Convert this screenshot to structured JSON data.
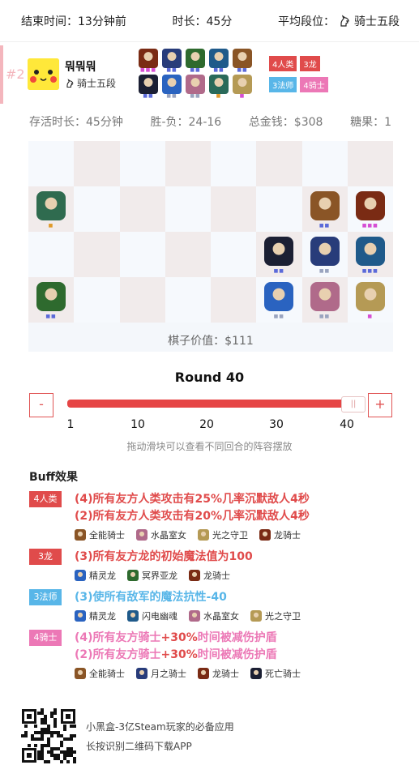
{
  "topbar": {
    "end_time": "结束时间：13分钟前",
    "duration": "时长：45分",
    "avg_rank": "平均段位：",
    "avg_rank_value": "骑士五段"
  },
  "player": {
    "rank": "#2",
    "name": "뭐뭐뭐",
    "tier": "骑士五段",
    "units": [
      {
        "color": "#7a2b14",
        "stars": 3,
        "star_color": "#d64fd4"
      },
      {
        "color": "#283c7a",
        "stars": 2,
        "star_color": "#5b6ad9"
      },
      {
        "color": "#2e6a2e",
        "stars": 2,
        "star_color": "#5b6ad9"
      },
      {
        "color": "#1f5a8a",
        "stars": 2,
        "star_color": "#5b6ad9"
      },
      {
        "color": "#8a5526",
        "stars": 2,
        "star_color": "#5b6ad9"
      },
      {
        "color": "#1b1f33",
        "stars": 2,
        "star_color": "#5b6ad9"
      },
      {
        "color": "#2a63c0",
        "stars": 2,
        "star_color": "#9aa4bf"
      },
      {
        "color": "#b06a8a",
        "stars": 2,
        "star_color": "#9aa4bf"
      },
      {
        "color": "#2a6a5a",
        "stars": 1,
        "star_color": "#e09a2a"
      },
      {
        "color": "#b59a55",
        "stars": 1,
        "star_color": "#d64fd4"
      }
    ],
    "tags": [
      {
        "label": "4人类",
        "color": "#e04b4b"
      },
      {
        "label": "3龙",
        "color": "#e04b4b"
      },
      {
        "label": "3法师",
        "color": "#58b6e8"
      },
      {
        "label": "4骑士",
        "color": "#ec78b6"
      }
    ]
  },
  "stats": {
    "alive": "存活时长：45分钟",
    "winloss": "胜-负：24-16",
    "gold": "总金钱：$308",
    "candy": "糖果：1"
  },
  "board": {
    "value": "棋子价值：$111",
    "pieces": [
      {
        "name": "green-dragon-piece",
        "col": 0,
        "row": 1,
        "color": "#2f6b4f",
        "stars": 1,
        "star_color": "#e09a2a"
      },
      {
        "name": "brown-knight-piece",
        "col": 6,
        "row": 1,
        "color": "#8a5526",
        "stars": 2,
        "star_color": "#5b6ad9"
      },
      {
        "name": "dragon-knight-piece",
        "col": 7,
        "row": 1,
        "color": "#7a2b14",
        "stars": 3,
        "star_color": "#d64fd4"
      },
      {
        "name": "dark-knight-piece",
        "col": 5,
        "row": 2,
        "color": "#1b1f33",
        "stars": 2,
        "star_color": "#5b6ad9"
      },
      {
        "name": "moon-knight-piece",
        "col": 6,
        "row": 2,
        "color": "#283c7a",
        "stars": 2,
        "star_color": "#9aa4bf"
      },
      {
        "name": "storm-spirit-piece",
        "col": 7,
        "row": 2,
        "color": "#1f5a8a",
        "stars": 3,
        "star_color": "#5b6ad9"
      },
      {
        "name": "venomancer-piece",
        "col": 0,
        "row": 3,
        "color": "#2e6a2e",
        "stars": 2,
        "star_color": "#5b6ad9"
      },
      {
        "name": "puck-piece",
        "col": 5,
        "row": 3,
        "color": "#2a63c0",
        "stars": 2,
        "star_color": "#9aa4bf"
      },
      {
        "name": "crystal-maiden-piece",
        "col": 6,
        "row": 3,
        "color": "#b06a8a",
        "stars": 2,
        "star_color": "#9aa4bf"
      },
      {
        "name": "keeper-piece",
        "col": 7,
        "row": 3,
        "color": "#b59a55",
        "stars": 1,
        "star_color": "#d64fd4"
      }
    ]
  },
  "round": {
    "title": "Round 40",
    "minus": "-",
    "plus": "+",
    "handle": "||",
    "current": 40,
    "min": 1,
    "max": 40,
    "ticks": [
      "1",
      "10",
      "20",
      "30",
      "40"
    ],
    "hint": "拖动滑块可以查看不同回合的阵容摆放"
  },
  "buffs": {
    "title": "Buff效果",
    "items": [
      {
        "tag": "4人类",
        "tag_color": "#e04b4b",
        "text_color": "#e04b4b",
        "lines": [
          [
            "(4)所有友方人类攻击有",
            "25%",
            "几率沉默敌人",
            "4",
            "秒"
          ],
          [
            "(2)所有友方人类攻击有",
            "20%",
            "几率沉默敌人",
            "4",
            "秒"
          ]
        ],
        "heroes": [
          {
            "name": "全能骑士",
            "color": "#8a5526"
          },
          {
            "name": "水晶室女",
            "color": "#b06a8a"
          },
          {
            "name": "光之守卫",
            "color": "#b59a55"
          },
          {
            "name": "龙骑士",
            "color": "#7a2b14"
          }
        ]
      },
      {
        "tag": "3龙",
        "tag_color": "#e04b4b",
        "text_color": "#e04b4b",
        "lines": [
          [
            "(3)所有友方龙的初始魔法值为",
            "100",
            "",
            "",
            ""
          ]
        ],
        "heroes": [
          {
            "name": "精灵龙",
            "color": "#2a63c0"
          },
          {
            "name": "冥界亚龙",
            "color": "#2e6a2e"
          },
          {
            "name": "龙骑士",
            "color": "#7a2b14"
          }
        ]
      },
      {
        "tag": "3法师",
        "tag_color": "#58b6e8",
        "text_color": "#58b6e8",
        "lines": [
          [
            "(3)使所有敌军的魔法抗性",
            "-40",
            "",
            "",
            ""
          ]
        ],
        "heroes": [
          {
            "name": "精灵龙",
            "color": "#2a63c0"
          },
          {
            "name": "闪电幽魂",
            "color": "#1f5a8a"
          },
          {
            "name": "水晶室女",
            "color": "#b06a8a"
          },
          {
            "name": "光之守卫",
            "color": "#b59a55"
          }
        ]
      },
      {
        "tag": "4骑士",
        "tag_color": "#ec78b6",
        "text_color": "#ec78b6",
        "lines": [
          [
            "(4)所有友方骑士",
            "+30%",
            "时间被减伤护盾",
            "",
            ""
          ],
          [
            "(2)所有友方骑士",
            "+30%",
            "时间被减伤护盾",
            "",
            ""
          ]
        ],
        "heroes": [
          {
            "name": "全能骑士",
            "color": "#8a5526"
          },
          {
            "name": "月之骑士",
            "color": "#283c7a"
          },
          {
            "name": "龙骑士",
            "color": "#7a2b14"
          },
          {
            "name": "死亡骑士",
            "color": "#1b1f33"
          }
        ]
      }
    ]
  },
  "footer": {
    "line1": "小黑盒-3亿Steam玩家的必备应用",
    "line2": "长按识别二维码下载APP"
  }
}
